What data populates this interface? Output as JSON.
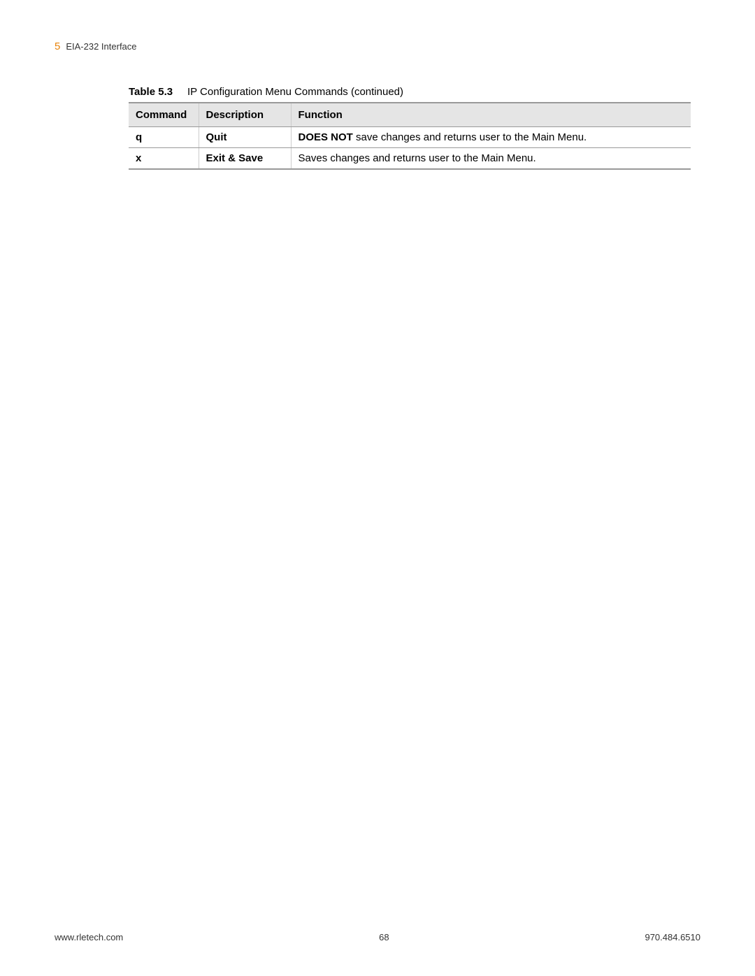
{
  "header": {
    "chapter_number": "5",
    "chapter_title": "EIA-232 Interface"
  },
  "table": {
    "caption_label": "Table 5.3",
    "caption_text": "IP Configuration Menu Commands (continued)",
    "headers": {
      "command": "Command",
      "description": "Description",
      "function": "Function"
    },
    "rows": [
      {
        "command": "q",
        "description": "Quit",
        "function_bold": "DOES NOT",
        "function_rest": " save changes and returns user to the Main Menu."
      },
      {
        "command": "x",
        "description": "Exit & Save",
        "function_bold": "",
        "function_rest": "Saves changes and returns user to the Main Menu."
      }
    ]
  },
  "footer": {
    "url": "www.rletech.com",
    "page_number": "68",
    "phone": "970.484.6510"
  }
}
